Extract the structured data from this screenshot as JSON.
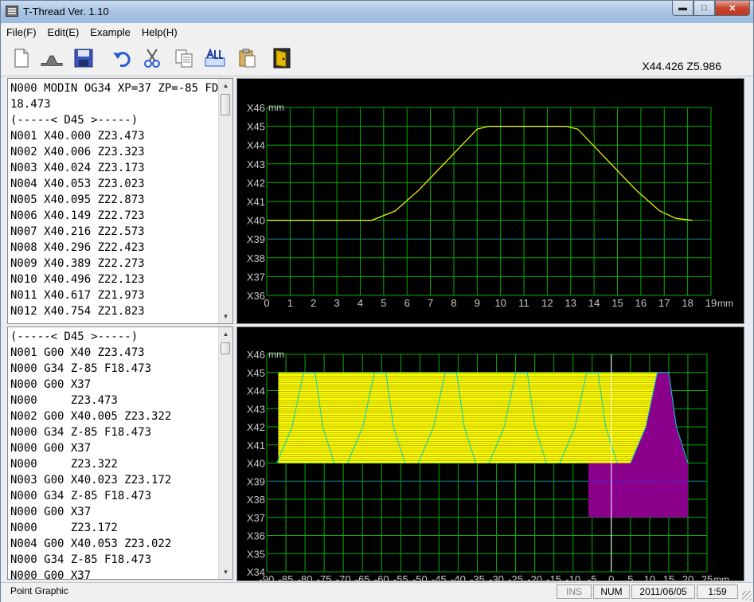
{
  "window": {
    "title": "T-Thread  Ver. 1.10"
  },
  "menu": [
    "File(F)",
    "Edit(E)",
    "Example",
    "Help(H)"
  ],
  "toolbar": {
    "coords": "X44.426  Z5.986",
    "buttons": [
      "new-file-icon",
      "thread-profile-icon",
      "save-icon",
      "undo-icon",
      "cut-icon",
      "copy-icon",
      "select-all-icon",
      "paste-icon",
      "exit-door-icon"
    ]
  },
  "editor_top": {
    "lines": [
      "N000 MODIN OG34 XP=37 ZP=-85 FD=",
      "18.473",
      "(-----< D45 >-----)",
      "N001 X40.000 Z23.473",
      "N002 X40.006 Z23.323",
      "N003 X40.024 Z23.173",
      "N004 X40.053 Z23.023",
      "N005 X40.095 Z22.873",
      "N006 X40.149 Z22.723",
      "N007 X40.216 Z22.573",
      "N008 X40.296 Z22.423",
      "N009 X40.389 Z22.273",
      "N010 X40.496 Z22.123",
      "N011 X40.617 Z21.973",
      "N012 X40.754 Z21.823"
    ]
  },
  "editor_bottom": {
    "lines": [
      "(-----< D45 >-----)",
      "N001 G00 X40 Z23.473",
      "N000 G34 Z-85 F18.473",
      "N000 G00 X37",
      "N000     Z23.473",
      "N002 G00 X40.005 Z23.322",
      "N000 G34 Z-85 F18.473",
      "N000 G00 X37",
      "N000     Z23.322",
      "N003 G00 X40.023 Z23.172",
      "N000 G34 Z-85 F18.473",
      "N000 G00 X37",
      "N000     Z23.172",
      "N004 G00 X40.053 Z23.022",
      "N000 G34 Z-85 F18.473",
      "N000 G00 X37"
    ]
  },
  "chart_data": [
    {
      "type": "line",
      "ylabel": "mm",
      "xlabel": "mm",
      "y_ticks": [
        "X46",
        "X45",
        "X44",
        "X43",
        "X42",
        "X41",
        "X40",
        "X39",
        "X38",
        "X37",
        "X36"
      ],
      "x_ticks": [
        "0",
        "1",
        "2",
        "3",
        "4",
        "5",
        "6",
        "7",
        "8",
        "9",
        "10",
        "11",
        "12",
        "13",
        "14",
        "15",
        "16",
        "17",
        "18",
        "19"
      ],
      "xlim": [
        0,
        19
      ],
      "ylim": [
        36,
        46
      ],
      "grid": true,
      "colors": {
        "grid": "#00b000",
        "profile": "#ffff00",
        "baseline": "#2040ff",
        "text": "#c8c8c8"
      },
      "series": [
        {
          "x": [
            0,
            4.5,
            5.5,
            6.5,
            7.5,
            8.5,
            9.0,
            9.5,
            12.8,
            13.3,
            13.8,
            14.8,
            15.8,
            16.8,
            17.5,
            18.2
          ],
          "y": [
            40,
            40,
            40.5,
            41.6,
            42.9,
            44.2,
            44.85,
            45,
            45,
            44.85,
            44.2,
            42.9,
            41.6,
            40.5,
            40.1,
            40
          ]
        }
      ],
      "baseline_y": 39
    },
    {
      "type": "area",
      "ylabel": "mm",
      "xlabel": "mm",
      "y_ticks": [
        "X46",
        "X45",
        "X44",
        "X43",
        "X42",
        "X41",
        "X40",
        "X39",
        "X38",
        "X37",
        "X36",
        "X35",
        "X34"
      ],
      "x_ticks": [
        "-90",
        "-85",
        "-80",
        "-75",
        "-70",
        "-65",
        "-60",
        "-55",
        "-50",
        "-45",
        "-40",
        "-35",
        "-30",
        "-25",
        "-20",
        "-15",
        "-10",
        "-5",
        "0",
        "5",
        "10",
        "15",
        "20",
        "25"
      ],
      "xlim": [
        -90,
        25
      ],
      "ylim": [
        34,
        46
      ],
      "grid": true,
      "colors": {
        "grid": "#00b000",
        "fill": "#ffff00",
        "thread": "#00d0d0",
        "workpiece": "#8b008b",
        "baseline": "#2040ff",
        "zero_line": "#ffffff",
        "text": "#c8c8c8"
      },
      "pass_band": {
        "x_start": -87,
        "x_end": 12,
        "y_low": 40,
        "y_high": 45
      },
      "thread_profile": {
        "pitch": 18.473,
        "x": [
          5,
          9,
          12,
          15,
          17,
          20
        ],
        "y": [
          40,
          42,
          45,
          45,
          42,
          40
        ]
      },
      "workpiece": {
        "x": [
          -90,
          -6,
          20
        ],
        "y_bottom": 37,
        "y_top": 40
      },
      "baseline_y": 39
    }
  ],
  "status": {
    "message": "Point Graphic",
    "ins": "INS",
    "num": "NUM",
    "date": "2011/06/05",
    "time": "1:59"
  }
}
